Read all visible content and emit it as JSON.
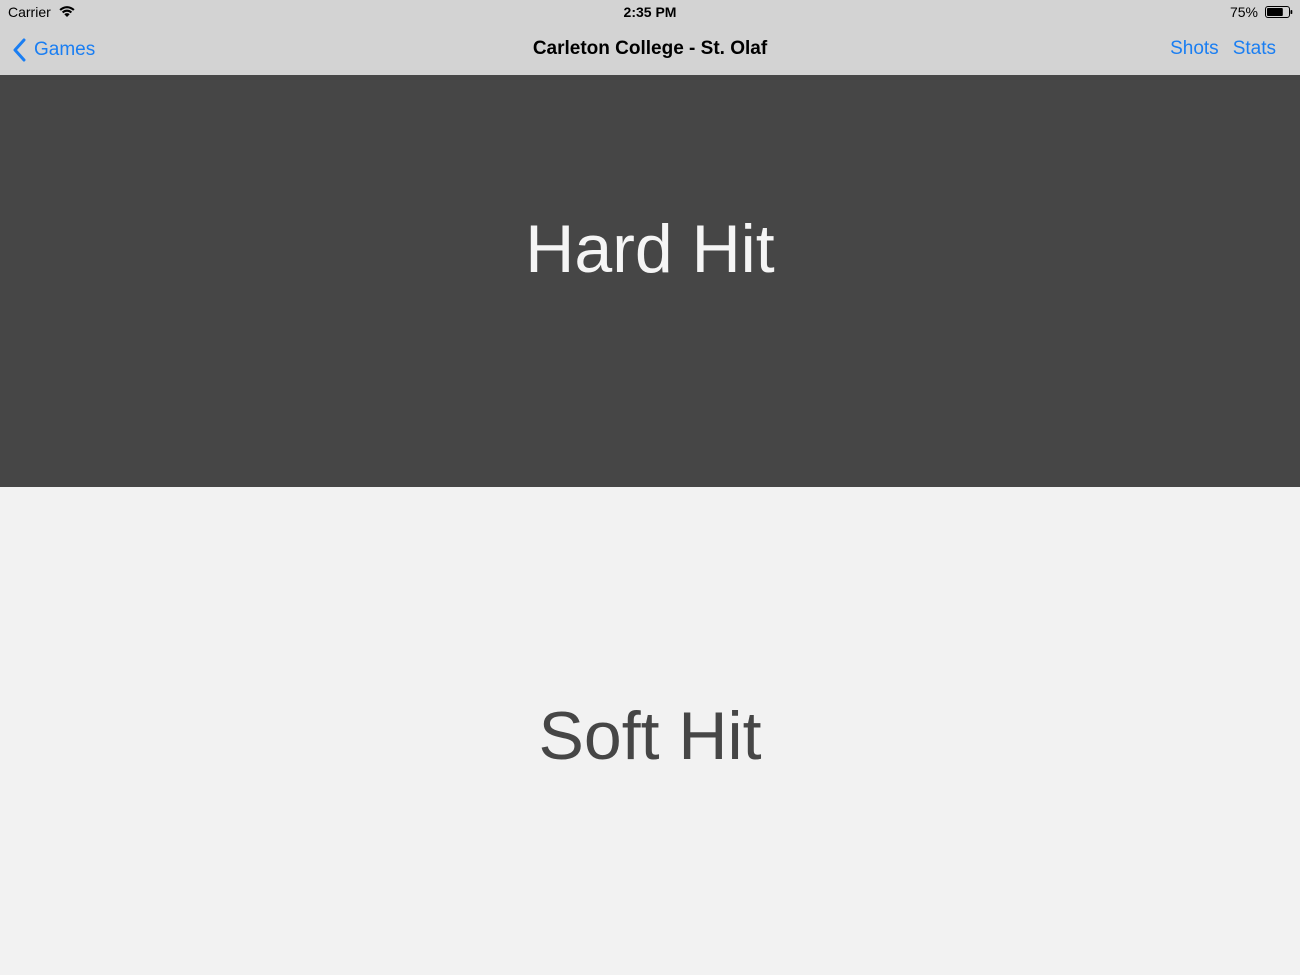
{
  "status_bar": {
    "carrier": "Carrier",
    "time": "2:35 PM",
    "battery_pct": "75%",
    "battery_level": 0.75,
    "wifi_icon": "wifi-icon",
    "battery_icon": "battery-icon"
  },
  "nav": {
    "back_label": "Games",
    "back_icon": "chevron-left-icon",
    "title": "Carleton College - St. Olaf",
    "actions": [
      "Shots",
      "Stats"
    ]
  },
  "buttons": {
    "hard_hit": "Hard Hit",
    "soft_hit": "Soft Hit"
  },
  "colors": {
    "accent": "#1a7ef2",
    "bar_bg": "#d3d3d3",
    "dark_panel": "#464646",
    "light_panel": "#f2f2f2"
  }
}
